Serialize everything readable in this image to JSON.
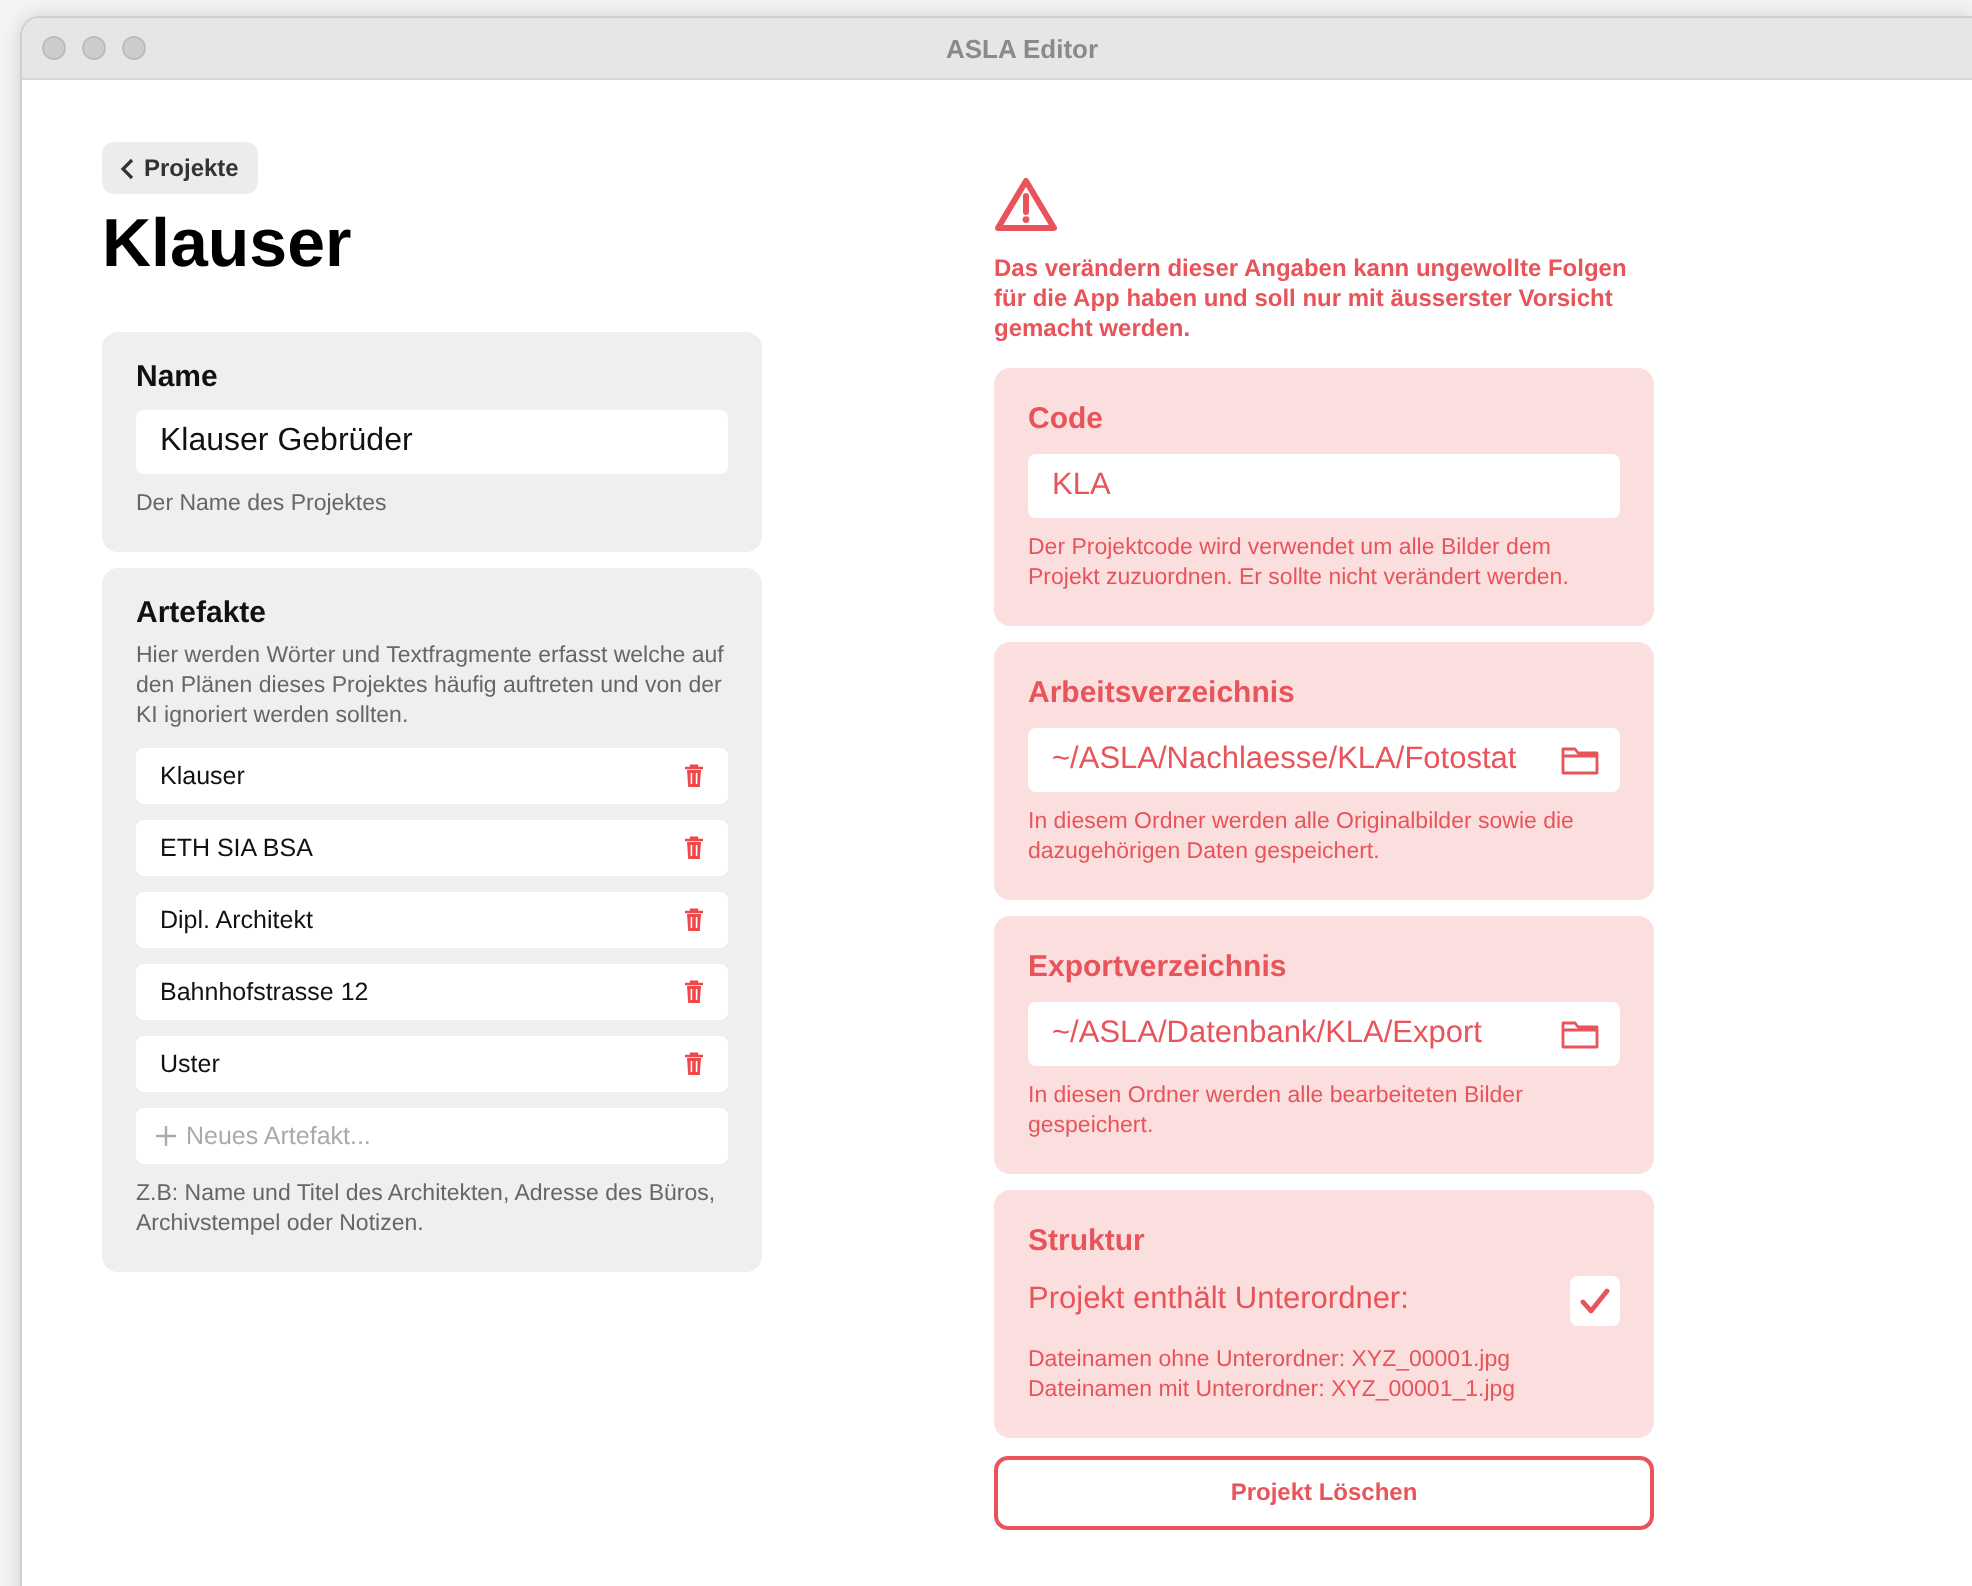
{
  "window": {
    "title": "ASLA Editor"
  },
  "back_button": {
    "label": "Projekte"
  },
  "title": "Klauser",
  "name_card": {
    "heading": "Name",
    "value": "Klauser Gebrüder",
    "hint": "Der Name des Projektes"
  },
  "artefacts_card": {
    "heading": "Artefakte",
    "description": "Hier werden Wörter und Textfragmente erfasst welche auf den Plänen dieses Projektes häufig auftreten und von der KI ignoriert werden sollten.",
    "items": [
      {
        "label": "Klauser"
      },
      {
        "label": "ETH SIA BSA"
      },
      {
        "label": "Dipl. Architekt"
      },
      {
        "label": "Bahnhofstrasse 12"
      },
      {
        "label": "Uster"
      }
    ],
    "new_item": {
      "placeholder": "Neues Artefakt..."
    },
    "hint": "Z.B: Name und Titel des Architekten, Adresse des Büros, Archivstempel oder Notizen."
  },
  "warning": {
    "text": "Das verändern dieser Angaben kann ungewollte Folgen für die App haben und soll nur mit äusserster Vorsicht gemacht werden."
  },
  "danger_cards": [
    {
      "kind": "text",
      "heading": "Code",
      "value": "KLA",
      "hint": "Der Projektcode wird verwendet um alle Bilder dem Projekt zuzuordnen. Er sollte nicht verändert werden."
    },
    {
      "kind": "folder",
      "heading": "Arbeitsverzeichnis",
      "value": "~/ASLA/Nachlaesse/KLA/Fotostat",
      "hint": "In diesem Ordner werden alle Originalbilder sowie die dazugehörigen Daten gespeichert."
    },
    {
      "kind": "folder",
      "heading": "Exportverzeichnis",
      "value": "~/ASLA/Datenbank/KLA/Export",
      "hint": "In diesen Ordner werden alle bearbeiteten Bilder gespeichert."
    },
    {
      "kind": "checkbox",
      "heading": "Struktur",
      "label": "Projekt enthält Unterordner:",
      "checked": true,
      "hint_lines": [
        "Dateinamen ohne Unterordner: XYZ_00001.jpg",
        "Dateinamen mit Unterordner: XYZ_00001_1.jpg"
      ]
    }
  ],
  "delete_button": {
    "label": "Projekt Löschen"
  }
}
